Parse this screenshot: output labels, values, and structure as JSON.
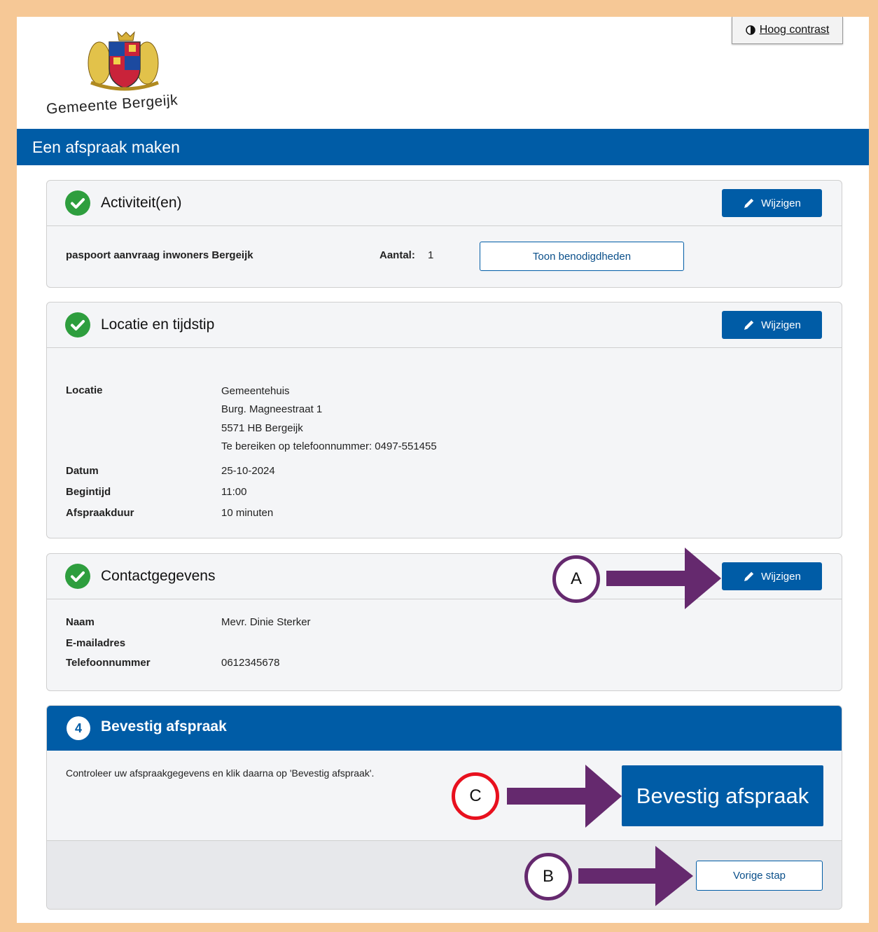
{
  "header": {
    "logo_text": "Gemeente Bergeijk",
    "contrast_button": "Hoog contrast",
    "banner_title": "Een afspraak maken"
  },
  "activities": {
    "title": "Activiteit(en)",
    "edit_label": "Wijzigen",
    "item_name": "paspoort aanvraag inwoners Bergeijk",
    "count_label": "Aantal:",
    "count_value": "1",
    "requirements_button": "Toon benodigdheden"
  },
  "location": {
    "title": "Locatie en tijdstip",
    "edit_label": "Wijzigen",
    "location_label": "Locatie",
    "address_lines": [
      "Gemeentehuis",
      "Burg. Magneestraat 1",
      "5571 HB Bergeijk",
      "Te bereiken op telefoonnummer: 0497-551455"
    ],
    "date_label": "Datum",
    "date_value": "25-10-2024",
    "start_label": "Begintijd",
    "start_value": "11:00",
    "duration_label": "Afspraakduur",
    "duration_value": "10 minuten"
  },
  "contact": {
    "title": "Contactgegevens",
    "edit_label": "Wijzigen",
    "name_label": "Naam",
    "name_value": "Mevr. Dinie Sterker",
    "email_label": "E-mailadres",
    "email_value": "",
    "phone_label": "Telefoonnummer",
    "phone_value": "0612345678"
  },
  "confirm": {
    "step_number": "4",
    "title": "Bevestig afspraak",
    "instruction": "Controleer uw afspraakgegevens en klik daarna op 'Bevestig afspraak'.",
    "confirm_button": "Bevestig afspraak",
    "previous_button": "Vorige stap"
  },
  "annotations": {
    "a": "A",
    "b": "B",
    "c": "C"
  },
  "colors": {
    "brand_blue": "#005ca6",
    "check_green": "#2e9e3e",
    "frame_orange": "#f6c896",
    "annotation_purple": "#65296e",
    "annotation_red": "#e8101e"
  }
}
